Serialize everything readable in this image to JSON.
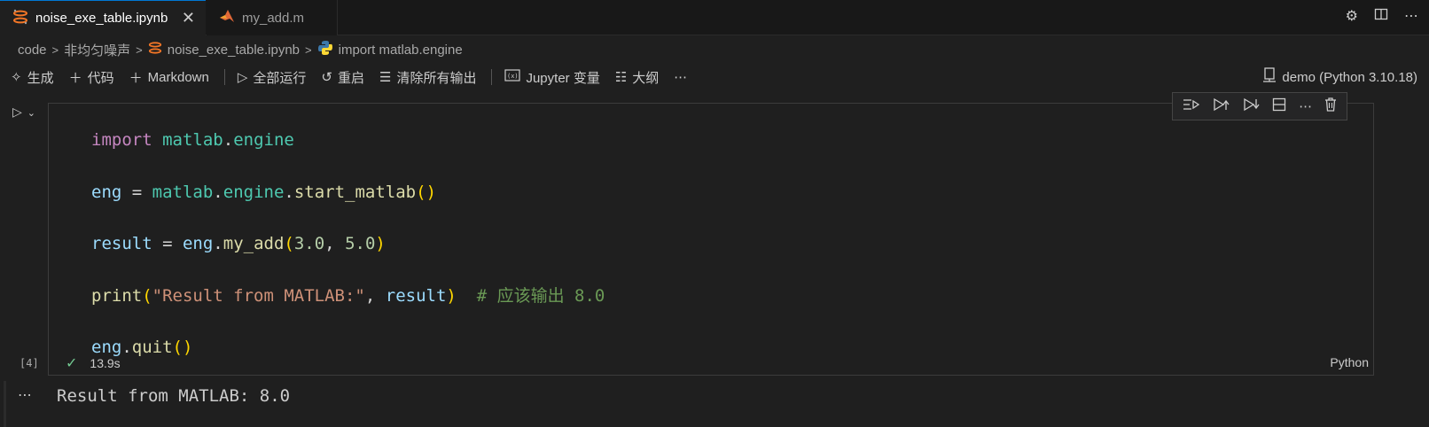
{
  "tabs": [
    {
      "label": "noise_exe_table.ipynb",
      "icon": "jupyter-icon",
      "active": true
    },
    {
      "label": "my_add.m",
      "icon": "matlab-icon",
      "active": false
    }
  ],
  "tab_close": "✕",
  "breadcrumb": [
    "code",
    "非均匀噪声",
    "noise_exe_table.ipynb",
    "import matlab.engine"
  ],
  "toolbar": {
    "generate": "生成",
    "add_code": "代码",
    "add_markdown": "Markdown",
    "run_all": "全部运行",
    "restart": "重启",
    "clear_outputs": "清除所有输出",
    "variables": "Jupyter 变量",
    "outline": "大纲",
    "more": "⋯"
  },
  "kernel": "demo (Python 3.10.18)",
  "cell": {
    "execution_count": "[4]",
    "duration": "13.9s",
    "language": "Python",
    "code": {
      "l1": {
        "kw": "import",
        "mod1": "matlab",
        "dot": ".",
        "mod2": "engine"
      },
      "l2": {
        "var": "eng",
        "eq": " = ",
        "mod1": "matlab",
        "dot1": ".",
        "mod2": "engine",
        "dot2": ".",
        "fn": "start_matlab",
        "open": "(",
        "close": ")"
      },
      "l3": {
        "var": "result",
        "eq": " = ",
        "obj": "eng",
        "dot": ".",
        "fn": "my_add",
        "open": "(",
        "n1": "3.0",
        "comma": ", ",
        "n2": "5.0",
        "close": ")"
      },
      "l4": {
        "fn": "print",
        "open": "(",
        "str": "\"Result from MATLAB:\"",
        "comma": ", ",
        "var": "result",
        "close": ")",
        "cmt": "  # 应该输出 8.0"
      },
      "l5": {
        "obj": "eng",
        "dot": ".",
        "fn": "quit",
        "open": "(",
        "close": ")"
      }
    }
  },
  "output": {
    "ellipsis": "⋯",
    "text": "Result from MATLAB: 8.0"
  }
}
